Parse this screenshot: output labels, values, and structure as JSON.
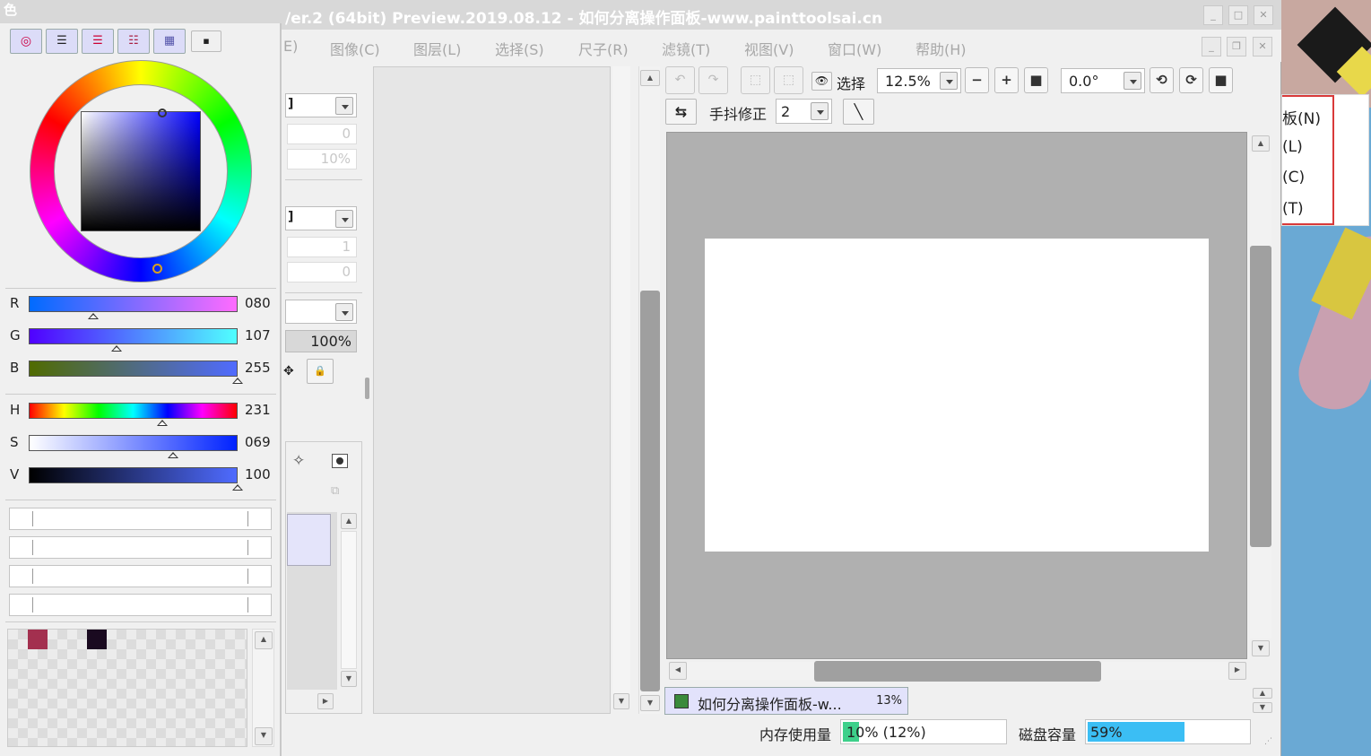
{
  "window": {
    "title": "/er.2 (64bit) Preview.2019.08.12 - 如何分离操作面板-www.painttoolsai.cn"
  },
  "menu": {
    "items": [
      "E)",
      "图像(C)",
      "图层(L)",
      "选择(S)",
      "尺子(R)",
      "滤镜(T)",
      "视图(V)",
      "窗口(W)",
      "帮助(H)"
    ]
  },
  "color_panel": {
    "title": "色",
    "rgb": {
      "r_label": "R",
      "r": "080",
      "g_label": "G",
      "g": "107",
      "b_label": "B",
      "b": "255",
      "r_level": 0.31,
      "g_level": 0.42,
      "b_level": 1.0
    },
    "hsv": {
      "h_label": "H",
      "h": "231",
      "s_label": "S",
      "s": "069",
      "v_label": "V",
      "v": "100",
      "h_level": 0.64,
      "s_level": 0.69,
      "v_level": 1.0
    },
    "wheel_hue_color": "#0000ff",
    "swatches": [
      "#a3304f",
      "#1a0a20"
    ]
  },
  "tool_panel": {
    "field_a": "0",
    "field_b": "10%",
    "field_c": "1",
    "field_d": "0",
    "opacity": "100%"
  },
  "toolbar": {
    "selection_label": "选择",
    "zoom": "12.5%",
    "rotation": "0.0°",
    "stabilizer_label": "手抖修正",
    "stabilizer_value": "2"
  },
  "document_tab": {
    "name": "如何分离操作面板-w...",
    "zoom": "13%"
  },
  "status": {
    "memory_label": "内存使用量",
    "memory_value": "10% (12%)",
    "memory_level": 0.1,
    "disk_label": "磁盘容量",
    "disk_value": "59%",
    "disk_level": 0.59
  },
  "overlay_menu": {
    "items": [
      "板(N)",
      "(L)",
      "(C)",
      "(T)"
    ]
  },
  "colors": {
    "canvas_bg": "#b0b0b0",
    "canvas": "#ffffff",
    "progress_mem": "#3dd08a",
    "progress_disk": "#3bbef4",
    "highlight": "#d93a3a"
  }
}
